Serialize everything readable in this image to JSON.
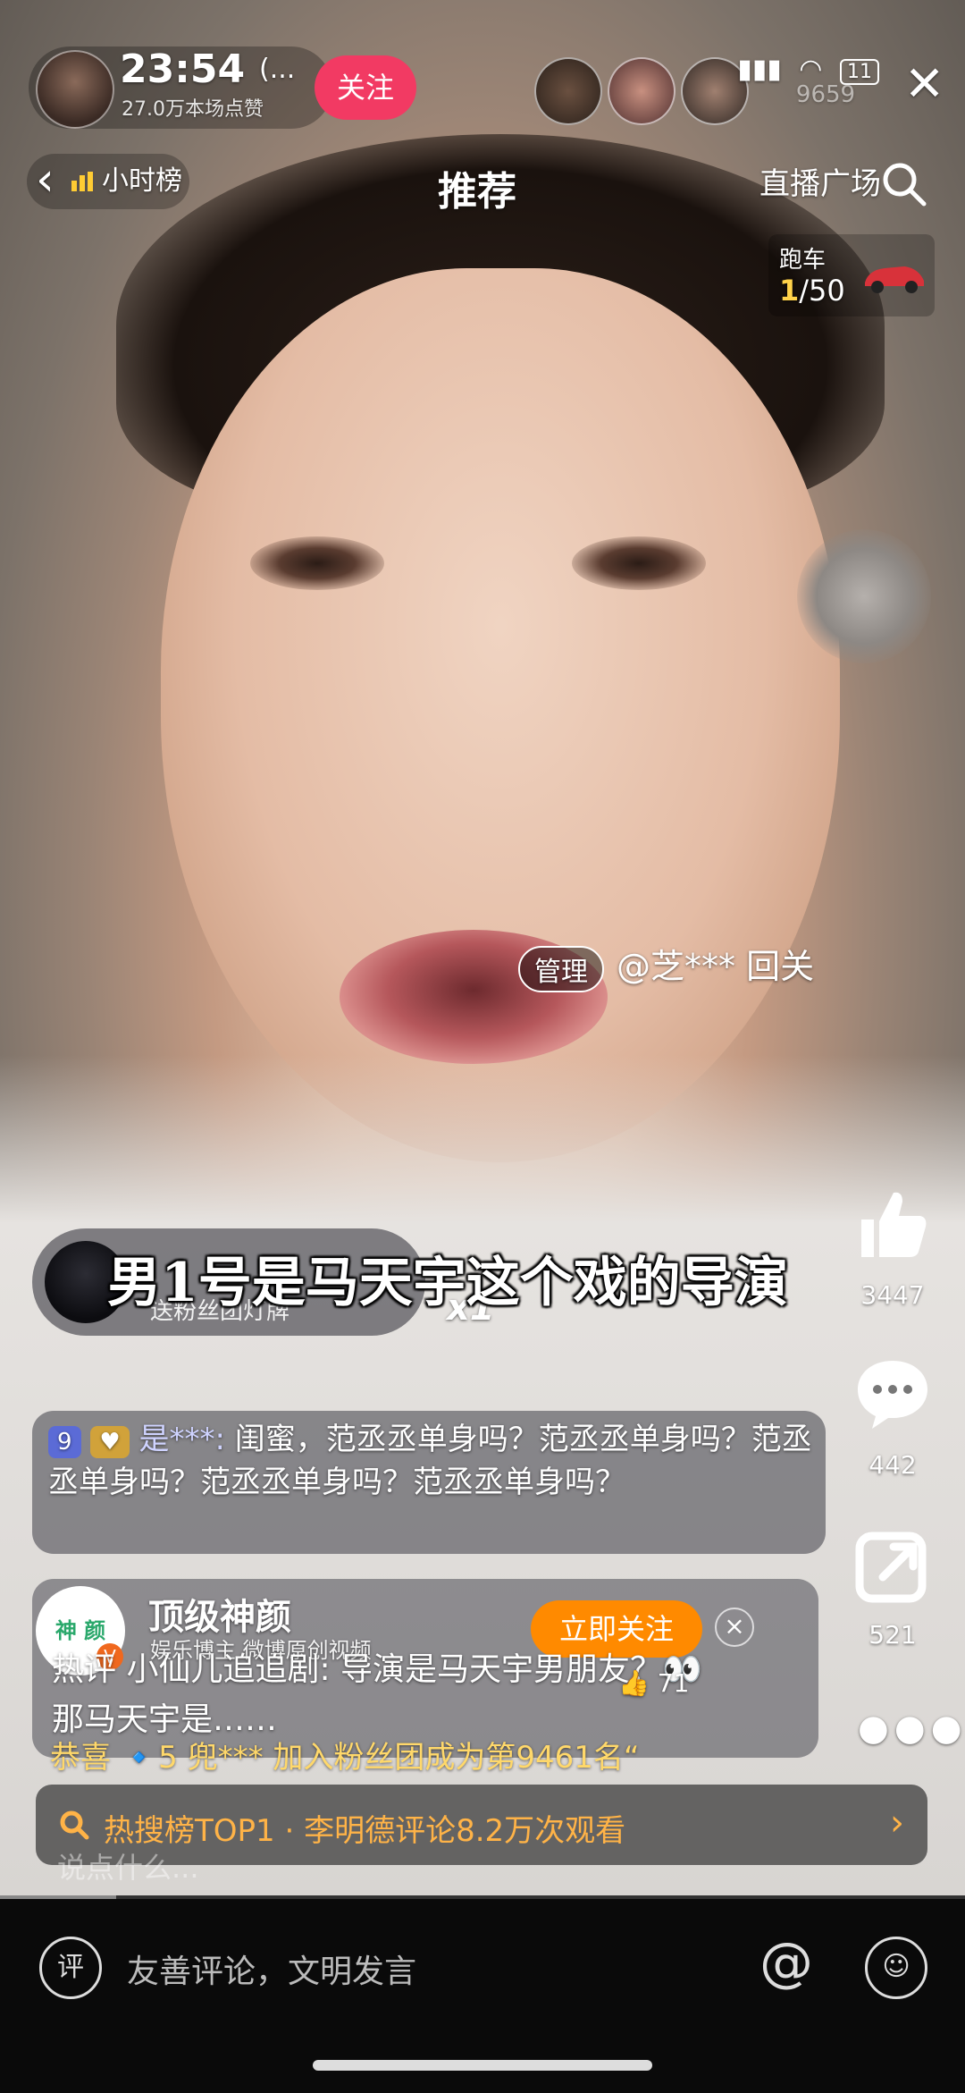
{
  "status_bar": {
    "time": "23:54",
    "battery": "11"
  },
  "anchor": {
    "name": "(...",
    "likes": "27.0万本场点赞",
    "follow_label": "关注"
  },
  "viewers": {
    "count": "9659"
  },
  "top_nav": {
    "hour_rank": "小时榜",
    "title": "推荐",
    "live_plaza": "直播广场"
  },
  "car_gift": {
    "name": "跑车",
    "current": "1",
    "total": "/50"
  },
  "admin_message": {
    "badge": "管理",
    "text": "@芝*** 回关"
  },
  "subtitle": "男1号是马天宇这个戏的导演",
  "fan_badge": {
    "sub": "送粉丝团灯牌",
    "mult": "x1"
  },
  "chat": {
    "msg1": {
      "level": "9",
      "user": "是***:",
      "text": "闺蜜，范丞丞单身吗？范丞丞单身吗？范丞丞单身吗？范丞丞单身吗？范丞丞单身吗？"
    },
    "gift_line": "恭喜 🔹5 兜*** 加入粉丝团成为第9461名“"
  },
  "weibo_card": {
    "avatar_text": "神 颜",
    "name": "顶级神颜",
    "sub": "娱乐博主 微博原创视频",
    "follow_label": "立即关注",
    "hot_comment": "热评 小仙儿追追剧: 导演是马天宇男朋友？👀那马天宇是……",
    "likes": "71"
  },
  "hot_search": {
    "text": "热搜榜TOP1 · 李明德评论8.2万次观看"
  },
  "chat_input_placeholder": "说点什么...",
  "right_rail": {
    "likes": "3447",
    "comments": "442",
    "shares": "521"
  },
  "progress": 0.12,
  "bottom_bar": {
    "comment_icon": "评",
    "placeholder": "友善评论，文明发言"
  }
}
